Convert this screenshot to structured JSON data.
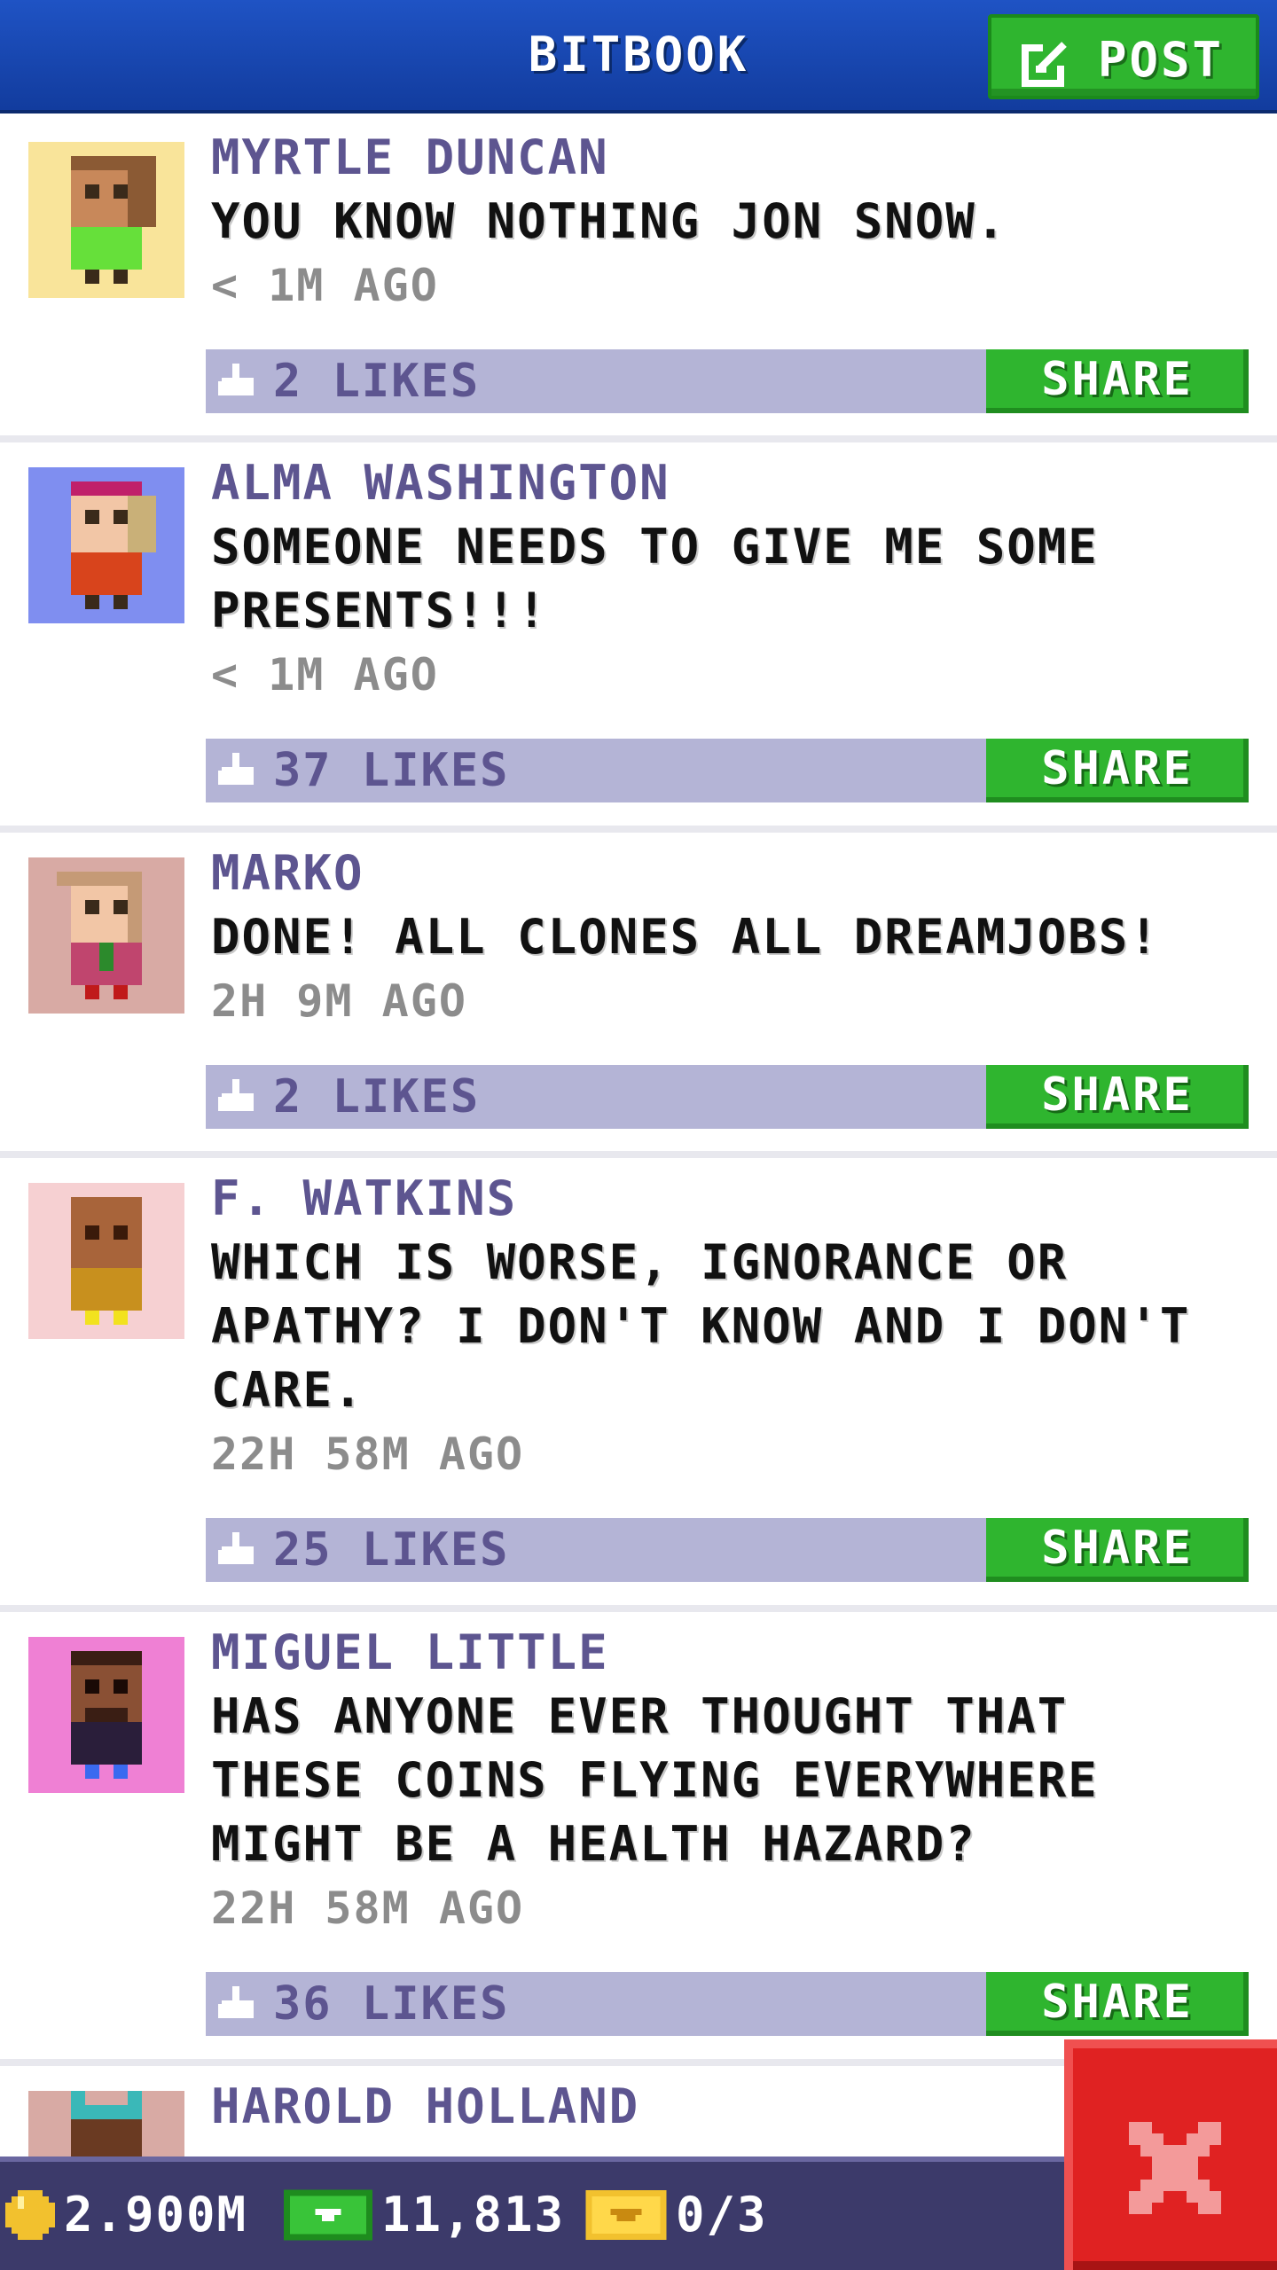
{
  "header": {
    "title": "BITBOOK",
    "post_label": "POST"
  },
  "posts": [
    {
      "name": "MYRTLE DUNCAN",
      "text": "YOU KNOW NOTHING JON SNOW.",
      "time": "< 1M AGO",
      "likes": "2 LIKES",
      "share": "SHARE",
      "avatar_bg": "#f9e49a"
    },
    {
      "name": "ALMA WASHINGTON",
      "text": "SOMEONE NEEDS TO GIVE ME SOME PRESENTS!!!",
      "time": "< 1M AGO",
      "likes": "37 LIKES",
      "share": "SHARE",
      "avatar_bg": "#7f8ef0"
    },
    {
      "name": "MARKO",
      "text": "DONE! ALL CLONES ALL DREAMJOBS!",
      "time": "2H 9M AGO",
      "likes": "2 LIKES",
      "share": "SHARE",
      "avatar_bg": "#d8aaa4"
    },
    {
      "name": "F. WATKINS",
      "text": "WHICH IS WORSE, IGNORANCE OR APATHY? I DON'T KNOW AND I DON'T CARE.",
      "time": "22H 58M AGO",
      "likes": "25 LIKES",
      "share": "SHARE",
      "avatar_bg": "#f6d0d2"
    },
    {
      "name": "MIGUEL LITTLE",
      "text": "HAS ANYONE EVER THOUGHT THAT THESE COINS FLYING EVERYWHERE MIGHT BE A HEALTH HAZARD?",
      "time": "22H 58M AGO",
      "likes": "36 LIKES",
      "share": "SHARE",
      "avatar_bg": "#ef80d4"
    },
    {
      "name": "HAROLD HOLLAND",
      "avatar_bg": "#d8aaa4"
    }
  ],
  "status_bar": {
    "coins": "2.900M",
    "bux": "11,813",
    "tickets": "0/3"
  },
  "icons": [
    "post-edit-icon",
    "thumbs-up-icon",
    "coin-icon",
    "bux-icon",
    "ticket-icon",
    "close-icon"
  ]
}
